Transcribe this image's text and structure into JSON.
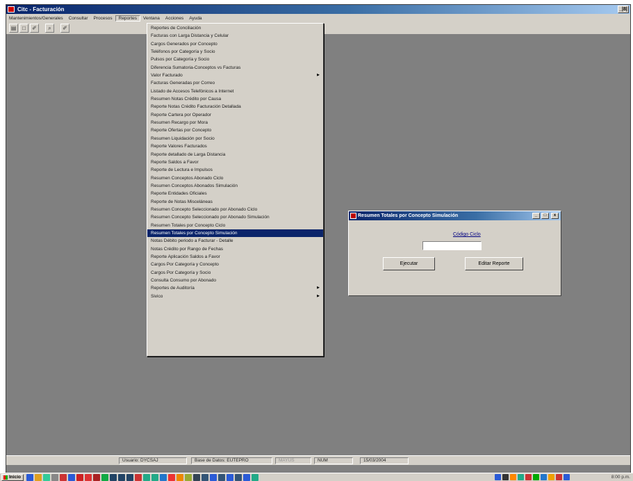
{
  "app": {
    "title": "Citc - Facturación",
    "restore_label": "_|8|"
  },
  "menubar": {
    "items": [
      {
        "label": "Mantenimientos/Generales"
      },
      {
        "label": "Consultar"
      },
      {
        "label": "Procesos"
      },
      {
        "label": "Reportes"
      },
      {
        "label": "Ventana"
      },
      {
        "label": "Acciones"
      },
      {
        "label": "Ayuda"
      }
    ]
  },
  "toolbar": {
    "buttons": [
      {
        "glyph": "▤"
      },
      {
        "glyph": "□"
      },
      {
        "glyph": "✐"
      },
      {
        "glyph": "⌕"
      },
      {
        "glyph": "✐"
      }
    ]
  },
  "dropdown": {
    "items": [
      {
        "label": "Reportes de Conciliación",
        "arrow": ""
      },
      {
        "label": "Facturas con Larga Distancia y Celular",
        "arrow": ""
      },
      {
        "label": "Cargos Generados por Concepto",
        "arrow": ""
      },
      {
        "label": "Teléfonos por Categoría y Socio",
        "arrow": ""
      },
      {
        "label": "Pulsos por Categoría y Socio",
        "arrow": ""
      },
      {
        "label": "Diferencia Sumatoria-Conceptos vs Facturas",
        "arrow": ""
      },
      {
        "label": "Valor Facturado",
        "arrow": "▶"
      },
      {
        "label": "Facturas Generadas por Correo",
        "arrow": ""
      },
      {
        "label": "Listado de Accesos Telefónicos a Internet",
        "arrow": ""
      },
      {
        "label": "Resumen Notas Crédito por Causa",
        "arrow": ""
      },
      {
        "label": "Reporte Notas Crédito Facturación Detallada",
        "arrow": ""
      },
      {
        "label": "Reporte Cartera por Operador",
        "arrow": ""
      },
      {
        "label": "Resumen Recargo por Mora",
        "arrow": ""
      },
      {
        "label": "Reporte Ofertas por Concepto",
        "arrow": ""
      },
      {
        "label": "Resumen Liquidación por Socio",
        "arrow": ""
      },
      {
        "label": "Reporte Valores Facturados",
        "arrow": ""
      },
      {
        "label": "Reporte detallado de Larga Distancia",
        "arrow": ""
      },
      {
        "label": "Reporte Saldos a Favor",
        "arrow": ""
      },
      {
        "label": "Reporte de Lectura e Impulsos",
        "arrow": ""
      },
      {
        "label": "Resumen Conceptos Abonado Ciclo",
        "arrow": ""
      },
      {
        "label": "Resumen Conceptos Abonados Simulación",
        "arrow": ""
      },
      {
        "label": "Reporte Entidades Oficiales",
        "arrow": ""
      },
      {
        "label": "Reporte de Notas Misceláneas",
        "arrow": ""
      },
      {
        "label": "Resumen Concepto Seleccionado por Abonado Ciclo",
        "arrow": ""
      },
      {
        "label": "Resumen Concepto Seleccionado por Abonado Simulación",
        "arrow": ""
      },
      {
        "label": "Resumen Totales por Concepto Ciclo",
        "arrow": ""
      },
      {
        "label": "Resumen Totales por Concepto Simulación",
        "arrow": ""
      },
      {
        "label": "Notas Débito periodo a Facturar - Detalle",
        "arrow": ""
      },
      {
        "label": "Notas Crédito por Rango de Fechas",
        "arrow": ""
      },
      {
        "label": "Reporte Aplicación Saldos a Favor",
        "arrow": ""
      },
      {
        "label": "Cargos Por Categoría y Concepto",
        "arrow": ""
      },
      {
        "label": "Cargos Por Categoría y Socio",
        "arrow": ""
      },
      {
        "label": "Consulta Consumo por Abonado",
        "arrow": ""
      },
      {
        "label": "Reportes de Auditoría",
        "arrow": "▶"
      },
      {
        "label": "Sivico",
        "arrow": "▶"
      }
    ]
  },
  "dialog": {
    "title": "Resumen Totales por Concepto Simulación",
    "minimize": "_",
    "maximize": "□",
    "close": "x",
    "field_label": "Código Ciclo",
    "field_value": "",
    "execute_label": "Ejecutar",
    "edit_label": "Editar Reporte"
  },
  "statusbar": {
    "user": "Usuario: DYCSAJ",
    "database": "Base de Datos: EUTEPRO",
    "caps": "MAYÚS",
    "num": "NÚM",
    "date": "15/03/2004"
  },
  "taskbar": {
    "start_label": "Inicio",
    "clock": "8:00 p.m."
  },
  "colors": {
    "highlight": "#0a246a",
    "desktop": "#808080",
    "face": "#d4d0c8"
  }
}
